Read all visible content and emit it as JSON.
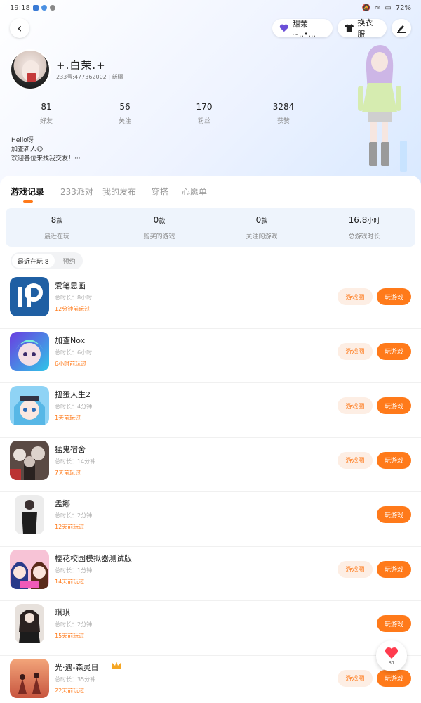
{
  "status_bar": {
    "time": "19:18",
    "battery": "72%"
  },
  "header": {
    "friend_pill": "甜茉~..•...",
    "cloth_pill": "换衣服",
    "username": "+.白茉.+",
    "user_id": "233号:477362002 | 新疆"
  },
  "stats": [
    {
      "value": "81",
      "label": "好友"
    },
    {
      "value": "56",
      "label": "关注"
    },
    {
      "value": "170",
      "label": "粉丝"
    },
    {
      "value": "3284",
      "label": "获赞"
    }
  ],
  "bio": [
    "Hello呀",
    "加查新人😋",
    "欢迎各位来找我交友！···"
  ],
  "tabs": [
    {
      "label": "游戏记录"
    },
    {
      "label": "233派对"
    },
    {
      "label": "我的发布"
    },
    {
      "label": "穿搭"
    },
    {
      "label": "心愿单"
    }
  ],
  "summary": [
    {
      "value": "8",
      "unit": "款",
      "label": "最近在玩"
    },
    {
      "value": "0",
      "unit": "款",
      "label": "购买的游戏"
    },
    {
      "value": "0",
      "unit": "款",
      "label": "关注的游戏"
    },
    {
      "value": "16.8",
      "unit": "小时",
      "label": "总游戏时长"
    }
  ],
  "subtabs": [
    {
      "label": "最近在玩 8"
    },
    {
      "label": "预约"
    }
  ],
  "buttons": {
    "circle": "游戏圈",
    "play": "玩游戏"
  },
  "games": [
    {
      "name": "爱笔思画",
      "duration": "总时长：8小时",
      "last": "12分钟前玩过",
      "has_circle": true,
      "icon": "ibis-paint-icon"
    },
    {
      "name": "加查Nox",
      "duration": "总时长：6小时",
      "last": "6小时前玩过",
      "has_circle": true,
      "icon": "gacha-nox-icon"
    },
    {
      "name": "扭蛋人生2",
      "duration": "总时长：4分钟",
      "last": "1天前玩过",
      "has_circle": true,
      "icon": "gacha-life-icon"
    },
    {
      "name": "猛鬼宿舍",
      "duration": "总时长：14分钟",
      "last": "7天前玩过",
      "has_circle": true,
      "icon": "ghost-dorm-icon"
    },
    {
      "name": "孟娜",
      "duration": "总时长：2分钟",
      "last": "12天前玩过",
      "has_circle": false,
      "icon": "photo-icon"
    },
    {
      "name": "樱花校园模拟器测试版",
      "duration": "总时长：1分钟",
      "last": "14天前玩过",
      "has_circle": true,
      "icon": "sakura-school-icon"
    },
    {
      "name": "琪琪",
      "duration": "总时长：2分钟",
      "last": "15天前玩过",
      "has_circle": false,
      "icon": "photo-icon"
    },
    {
      "name": "光·遇-森灵日",
      "duration": "总时长：35分钟",
      "last": "22天前玩过",
      "has_circle": true,
      "icon": "sky-icon"
    }
  ],
  "float_like": {
    "count": "81"
  }
}
